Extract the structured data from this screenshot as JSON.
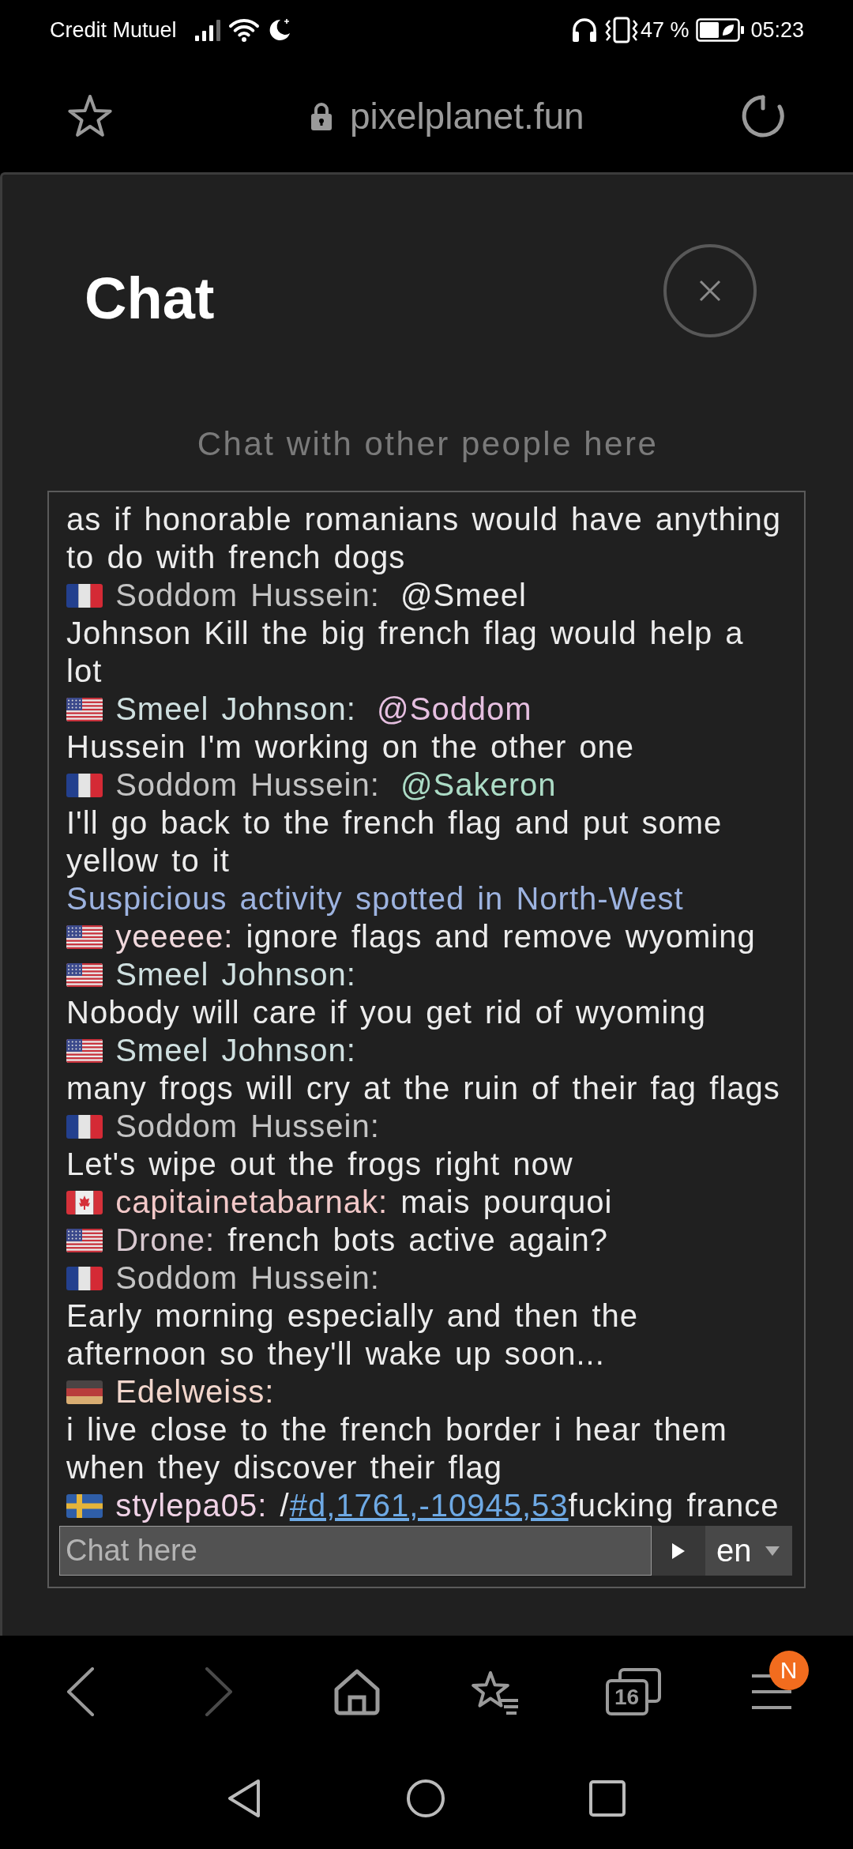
{
  "status_bar": {
    "carrier": "Credit Mutuel",
    "battery": "47 %",
    "time": "05:23"
  },
  "address_bar": {
    "url": "pixelplanet.fun"
  },
  "chat": {
    "title": "Chat",
    "subtitle": "Chat with other people here",
    "messages": [
      {
        "kind": "continuation",
        "text": "as if honorable romanians would have anything to do with french dogs"
      },
      {
        "kind": "user",
        "flag": {
          "kind": "france"
        },
        "name": "Soddom Hussein:",
        "color": "#c4c4c4",
        "mention": {
          "text": "@Smeel",
          "color": "#ececec"
        },
        "text": "Johnson Kill the big french flag would help a lot"
      },
      {
        "kind": "user",
        "flag": {
          "kind": "usa"
        },
        "name": "Smeel Johnson:",
        "color": "#cfe0e0",
        "mention": {
          "text": "@Soddom",
          "color": "#e6bfe0"
        },
        "text": "Hussein I'm working on the other one"
      },
      {
        "kind": "user",
        "flag": {
          "kind": "france"
        },
        "name": "Soddom Hussein:",
        "color": "#c4c4c4",
        "mention": {
          "text": "@Sakeron",
          "color": "#acdcc6"
        },
        "text": "I'll go back to the french flag and put some yellow to it"
      },
      {
        "kind": "info",
        "text": "Suspicious activity spotted in North-West"
      },
      {
        "kind": "user",
        "flag": {
          "kind": "usa"
        },
        "name": "yeeeee:",
        "color": "#f0d8dc",
        "text": "ignore flags and remove wyoming"
      },
      {
        "kind": "user",
        "flag": {
          "kind": "usa"
        },
        "name": "Smeel Johnson:",
        "color": "#cfe0e0",
        "text": "Nobody will care if you get rid of wyoming"
      },
      {
        "kind": "user",
        "flag": {
          "kind": "usa"
        },
        "name": "Smeel Johnson:",
        "color": "#cfe0e0",
        "text": "many frogs will cry at the ruin of their fag flags"
      },
      {
        "kind": "user",
        "flag": {
          "kind": "france"
        },
        "name": "Soddom Hussein:",
        "color": "#c4c4c4",
        "text": "Let's wipe out the frogs right now"
      },
      {
        "kind": "user",
        "flag": {
          "kind": "canada"
        },
        "name": "capitainetabarnak:",
        "color": "#f2c8c8",
        "text": "mais pourquoi"
      },
      {
        "kind": "user",
        "flag": {
          "kind": "usa"
        },
        "name": "Drone:",
        "color": "#d8c8d0",
        "text": "french bots active again?"
      },
      {
        "kind": "user",
        "flag": {
          "kind": "france"
        },
        "name": "Soddom Hussein:",
        "color": "#c4c4c4",
        "text": "Early morning especially and then the afternoon so they'll wake up soon..."
      },
      {
        "kind": "user",
        "flag": {
          "kind": "germany"
        },
        "name": "Edelweiss:",
        "color": "#f2d6cc",
        "text": "i live close to the french border i hear them when they discover their flag"
      },
      {
        "kind": "user",
        "flag": {
          "kind": "sweden"
        },
        "name": "stylepa05:",
        "color": "#f0d2e6",
        "parts": [
          {
            "kind": "plain",
            "text": "/"
          },
          {
            "kind": "link",
            "text": "#d,1761,-10945,53"
          },
          {
            "kind": "plain",
            "text": "fucking france"
          }
        ]
      }
    ],
    "input": {
      "placeholder": "Chat here"
    },
    "language": "en"
  },
  "toolbar": {
    "buttons": [
      {
        "kind": "back",
        "disabled": false
      },
      {
        "kind": "forward",
        "disabled": true
      },
      {
        "kind": "home",
        "disabled": false
      },
      {
        "kind": "bookmarks",
        "disabled": false
      },
      {
        "kind": "tabs",
        "count": "16",
        "disabled": false
      },
      {
        "kind": "menu",
        "badge": "N",
        "disabled": false
      }
    ]
  }
}
